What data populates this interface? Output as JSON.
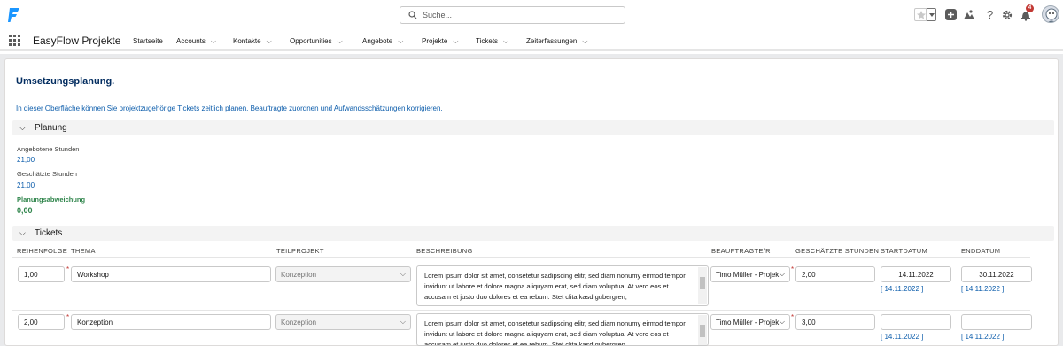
{
  "header": {
    "search_placeholder": "Suche...",
    "notification_count": "4"
  },
  "navbar": {
    "app_name": "EasyFlow Projekte",
    "items": [
      {
        "label": "Startseite",
        "has_menu": false
      },
      {
        "label": "Accounts",
        "has_menu": true
      },
      {
        "label": "Kontakte",
        "has_menu": true
      },
      {
        "label": "Opportunities",
        "has_menu": true
      },
      {
        "label": "Angebote",
        "has_menu": true
      },
      {
        "label": "Projekte",
        "has_menu": true
      },
      {
        "label": "Tickets",
        "has_menu": true
      },
      {
        "label": "Zeiterfassungen",
        "has_menu": true
      }
    ]
  },
  "page": {
    "title": "Umsetzungsplanung.",
    "intro": "In dieser Oberfläche können Sie projektzugehörige Tickets zeitlich planen, Beauftragte zuordnen und Aufwandsschätzungen korrigieren."
  },
  "planung": {
    "section_label": "Planung",
    "angebotene_label": "Angebotene Stunden",
    "angebotene_value": "21,00",
    "geschaetzte_label": "Geschätzte Stunden",
    "geschaetzte_value": "21,00",
    "abweichung_label": "Planungsabweichung",
    "abweichung_value": "0,00"
  },
  "tickets": {
    "section_label": "Tickets",
    "columns": {
      "reihenfolge": "REIHENFOLGE",
      "thema": "THEMA",
      "teilprojekt": "TEILPROJEKT",
      "beschreibung": "BESCHREIBUNG",
      "beauftragte": "BEAUFTRAGTE/R",
      "stunden": "GESCHÄTZTE STUNDEN",
      "startdatum": "STARTDATUM",
      "enddatum": "ENDDATUM"
    },
    "rows": [
      {
        "reihenfolge": "1,00",
        "thema": "Workshop",
        "teilprojekt": "Konzeption",
        "beschreibung": "Lorem ipsum dolor sit amet, consetetur sadipscing elitr, sed diam nonumy eirmod tempor invidunt ut labore et dolore magna aliquyam erat, sed diam voluptua. At vero eos et accusam et justo duo dolores et ea rebum. Stet clita kasd gubergren,",
        "beauftragte": "Timo Müller - Projek",
        "stunden": "2,00",
        "startdatum": "14.11.2022",
        "start_link": "14.11.2022",
        "enddatum": "30.11.2022",
        "end_link": "14.11.2022"
      },
      {
        "reihenfolge": "2,00",
        "thema": "Konzeption",
        "teilprojekt": "Konzeption",
        "beschreibung": "Lorem ipsum dolor sit amet, consetetur sadipscing elitr, sed diam nonumy eirmod tempor invidunt ut labore et dolore magna aliquyam erat, sed diam voluptua. At vero eos et accusam et justo duo dolores et ea rebum. Stet clita kasd gubergren,",
        "beauftragte": "Timo Müller - Projek",
        "stunden": "3,00",
        "startdatum": "",
        "start_link": "14.11.2022",
        "enddatum": "",
        "end_link": "14.11.2022"
      }
    ]
  }
}
